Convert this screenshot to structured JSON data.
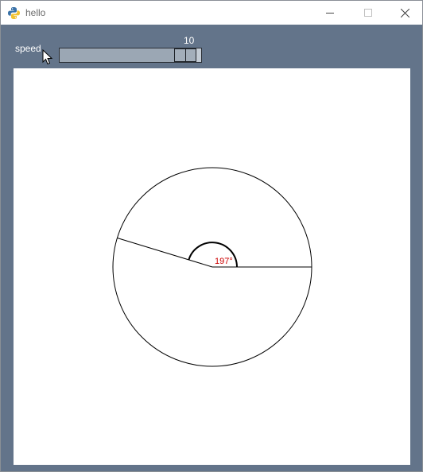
{
  "window": {
    "title": "hello"
  },
  "controls": {
    "speed_label": "speed",
    "speed_value": "10",
    "speed_fraction": 0.96
  },
  "canvas": {
    "angle_degrees": 197,
    "angle_label": "197°",
    "angle_label_color": "#cc0000"
  },
  "colors": {
    "background": "#63748a",
    "canvas": "#ffffff",
    "slider_track": "#c4ccd5",
    "slider_fill": "#9ba7b4"
  }
}
